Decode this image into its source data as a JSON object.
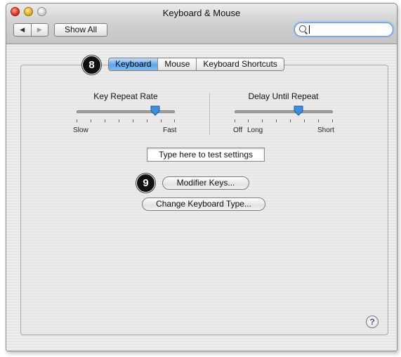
{
  "window": {
    "title": "Keyboard & Mouse"
  },
  "toolbar": {
    "back_glyph": "◀",
    "forward_glyph": "▶",
    "show_all_label": "Show All",
    "search_icon": "magnifier-icon",
    "search_value": ""
  },
  "tabs": [
    {
      "label": "Keyboard",
      "selected": true
    },
    {
      "label": "Mouse",
      "selected": false
    },
    {
      "label": "Keyboard Shortcuts",
      "selected": false
    }
  ],
  "callouts": {
    "tabs_marker": "8",
    "modifier_marker": "9"
  },
  "key_repeat": {
    "title": "Key Repeat Rate",
    "min_label": "Slow",
    "max_label": "Fast",
    "value_fraction": 0.8
  },
  "delay_until_repeat": {
    "title": "Delay Until Repeat",
    "min_label": "Off",
    "mid_label": "Long",
    "max_label": "Short",
    "value_fraction": 0.65
  },
  "test_field": {
    "text": "Type here to test settings"
  },
  "buttons": {
    "modifier_keys": "Modifier Keys...",
    "change_keyboard_type": "Change Keyboard Type..."
  },
  "help": {
    "glyph": "?"
  },
  "colors": {
    "selected_tab": "#5aa6ec",
    "slider_thumb": "#3d8ee0",
    "help_glyph": "#6a3a9a"
  }
}
